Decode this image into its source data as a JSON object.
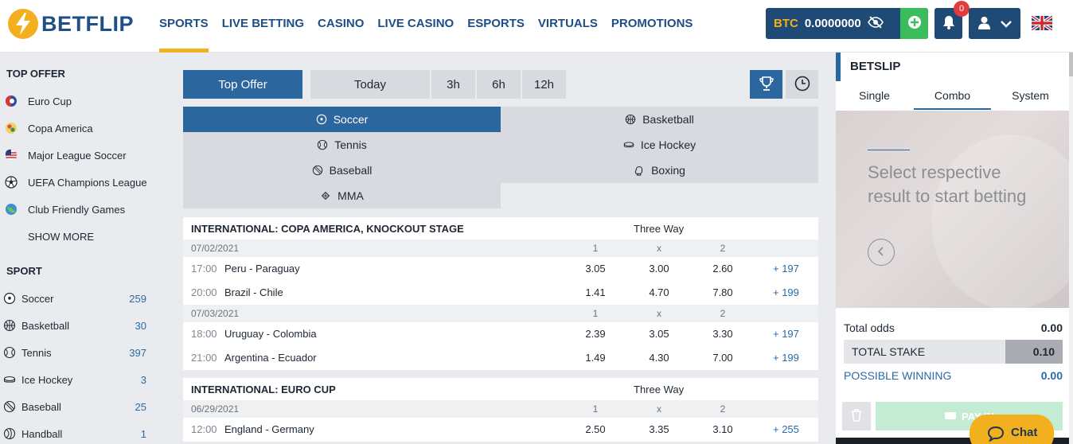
{
  "header": {
    "logo": "BETFLIP",
    "nav": [
      "SPORTS",
      "LIVE BETTING",
      "CASINO",
      "LIVE CASINO",
      "ESPORTS",
      "VIRTUALS",
      "PROMOTIONS"
    ],
    "active_nav": "SPORTS",
    "wallet": {
      "currency": "BTC",
      "balance": "0.0000000"
    },
    "notifications": "0",
    "icons": {
      "eye": "eye-slash-icon",
      "add": "plus-circle-icon",
      "bell": "bell-icon",
      "user": "user-icon",
      "chevron": "chevron-down-icon",
      "flag": "uk-flag-icon"
    },
    "colors": {
      "brand": "#1f4f86",
      "accent": "#f2b01e",
      "wallet_bg": "#1f4a75",
      "add_bg": "#3bbd5e"
    }
  },
  "sidebar": {
    "top_offer_title": "TOP OFFER",
    "top_offer": [
      {
        "label": "Euro Cup",
        "icon": "euro-cup-icon"
      },
      {
        "label": "Copa America",
        "icon": "copa-america-icon"
      },
      {
        "label": "Major League Soccer",
        "icon": "usa-flag-icon"
      },
      {
        "label": "UEFA Champions League",
        "icon": "soccer-ball-icon"
      },
      {
        "label": "Club Friendly Games",
        "icon": "globe-icon"
      }
    ],
    "show_more": "SHOW MORE",
    "sport_title": "SPORT",
    "sports": [
      {
        "label": "Soccer",
        "count": "259",
        "icon": "soccer-icon"
      },
      {
        "label": "Basketball",
        "count": "30",
        "icon": "basketball-icon"
      },
      {
        "label": "Tennis",
        "count": "397",
        "icon": "tennis-icon"
      },
      {
        "label": "Ice Hockey",
        "count": "3",
        "icon": "ice-hockey-icon"
      },
      {
        "label": "Baseball",
        "count": "25",
        "icon": "baseball-icon"
      },
      {
        "label": "Handball",
        "count": "1",
        "icon": "handball-icon"
      }
    ]
  },
  "filters": {
    "buttons": [
      "Top Offer",
      "Today",
      "3h",
      "6h",
      "12h"
    ],
    "active": "Top Offer",
    "trophy_icon": "trophy-icon",
    "clock_icon": "clock-icon"
  },
  "sport_tabs": [
    {
      "label": "Soccer",
      "icon": "soccer-icon",
      "active": true
    },
    {
      "label": "Basketball",
      "icon": "basketball-icon",
      "active": false
    },
    {
      "label": "Tennis",
      "icon": "tennis-icon",
      "active": false
    },
    {
      "label": "Ice Hockey",
      "icon": "ice-hockey-icon",
      "active": false
    },
    {
      "label": "Baseball",
      "icon": "baseball-icon",
      "active": false
    },
    {
      "label": "Boxing",
      "icon": "boxing-icon",
      "active": false
    },
    {
      "label": "MMA",
      "icon": "mma-icon",
      "active": false
    }
  ],
  "leagues": [
    {
      "name": "INTERNATIONAL: COPA AMERICA, KNOCKOUT STAGE",
      "market": "Three Way",
      "groups": [
        {
          "date": "07/02/2021",
          "headers": [
            "1",
            "x",
            "2"
          ],
          "matches": [
            {
              "time": "17:00",
              "teams": "Peru - Paraguay",
              "odds": [
                "3.05",
                "3.00",
                "2.60"
              ],
              "more": "+ 197"
            },
            {
              "time": "20:00",
              "teams": "Brazil - Chile",
              "odds": [
                "1.41",
                "4.70",
                "7.80"
              ],
              "more": "+ 199"
            }
          ]
        },
        {
          "date": "07/03/2021",
          "headers": [
            "1",
            "x",
            "2"
          ],
          "matches": [
            {
              "time": "18:00",
              "teams": "Uruguay - Colombia",
              "odds": [
                "2.39",
                "3.05",
                "3.30"
              ],
              "more": "+ 197"
            },
            {
              "time": "21:00",
              "teams": "Argentina - Ecuador",
              "odds": [
                "1.49",
                "4.30",
                "7.00"
              ],
              "more": "+ 199"
            }
          ]
        }
      ]
    },
    {
      "name": "INTERNATIONAL: EURO CUP",
      "market": "Three Way",
      "groups": [
        {
          "date": "06/29/2021",
          "headers": [
            "1",
            "x",
            "2"
          ],
          "matches": [
            {
              "time": "12:00",
              "teams": "England - Germany",
              "odds": [
                "2.50",
                "3.35",
                "3.10"
              ],
              "more": "+ 255"
            }
          ]
        }
      ]
    }
  ],
  "betslip": {
    "title": "BETSLIP",
    "tabs": [
      "Single",
      "Combo",
      "System"
    ],
    "active_tab": "Combo",
    "empty_message": "Select respective result to start betting",
    "total_odds_label": "Total odds",
    "total_odds": "0.00",
    "total_stake_label": "TOTAL STAKE",
    "total_stake": "0.10",
    "possible_winning_label": "POSSIBLE WINNING",
    "possible_winning": "0.00",
    "place_label": "PAY IN"
  },
  "chat": {
    "label": "Chat"
  }
}
